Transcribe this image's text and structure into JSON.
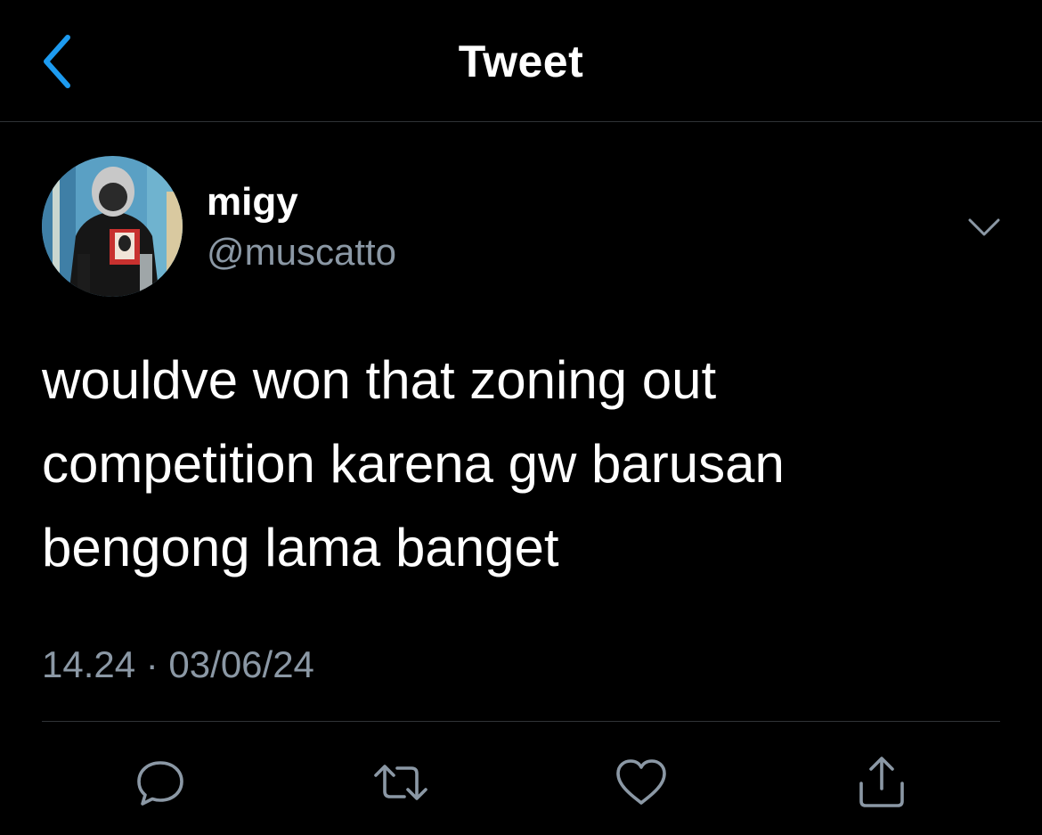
{
  "nav": {
    "title": "Tweet",
    "back_icon": "chevron-left-icon",
    "accent_color": "#1d9bf0"
  },
  "author": {
    "display_name": "migy",
    "handle": "@muscatto",
    "avatar": "profile-photo"
  },
  "tweet": {
    "lines": [
      "wouldve won that zoning out",
      "competition karena gw barusan",
      "bengong lama banget"
    ],
    "timestamp": "14.24 · 03/06/24"
  },
  "actions": [
    {
      "icon": "reply-icon"
    },
    {
      "icon": "retweet-icon"
    },
    {
      "icon": "like-icon"
    },
    {
      "icon": "share-icon"
    }
  ],
  "colors": {
    "background": "#000000",
    "text": "#ffffff",
    "secondary_text": "#8b98a5",
    "divider": "#2f3336",
    "icon_gray": "#8b98a5"
  }
}
